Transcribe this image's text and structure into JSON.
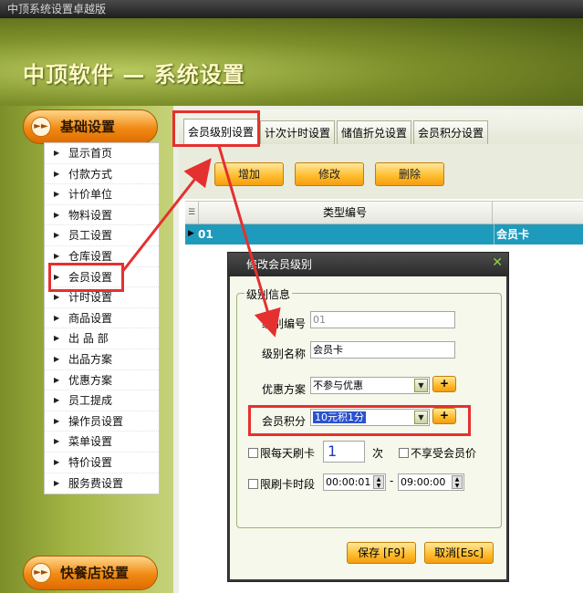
{
  "window": {
    "title": "中顶系统设置卓越版"
  },
  "banner": {
    "title": "中顶软件 — 系统设置"
  },
  "sidebar": {
    "category_top": "基础设置",
    "category_bottom": "快餐店设置",
    "items": [
      "显示首页",
      "付款方式",
      "计价单位",
      "物料设置",
      "员工设置",
      "仓库设置",
      "会员设置",
      "计时设置",
      "商品设置",
      "出 品 部",
      "出品方案",
      "优惠方案",
      "员工提成",
      "操作员设置",
      "菜单设置",
      "特价设置",
      "服务费设置"
    ]
  },
  "tabs": [
    "会员级别设置",
    "计次计时设置",
    "储值折兑设置",
    "会员积分设置"
  ],
  "toolbar": {
    "add": "增加",
    "edit": "修改",
    "delete": "删除"
  },
  "grid": {
    "header": "类型编号",
    "rows": [
      {
        "code": "01",
        "name": "会员卡"
      }
    ]
  },
  "dialog": {
    "title": "修改会员级别",
    "group": "级别信息",
    "fields": {
      "code_label": "级别编号",
      "code_value": "01",
      "name_label": "级别名称",
      "name_value": "会员卡",
      "discount_label": "优惠方案",
      "discount_value": "不参与优惠",
      "points_label": "会员积分",
      "points_value": "10元积1分",
      "daily_limit_label": "限每天刷卡",
      "daily_limit_value": "1",
      "daily_limit_unit": "次",
      "no_member_price_label": "不享受会员价",
      "time_limit_label": "限刷卡时段",
      "time_from": "00:00:01",
      "time_sep": "-",
      "time_to": "09:00:00"
    },
    "plus": "+",
    "save": "保存 [F9]",
    "cancel": "取消[Esc]"
  },
  "colors": {
    "annotation": "#e53030",
    "selected_row": "#1e9bbc",
    "button_orange": "#ffbb2a"
  }
}
